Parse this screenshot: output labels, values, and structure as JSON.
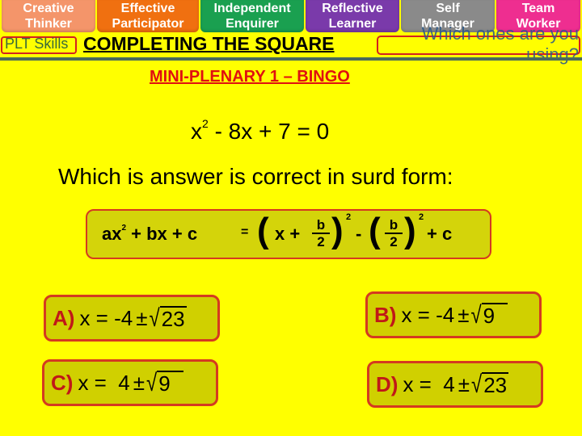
{
  "plt_tabs": [
    {
      "line1": "Creative",
      "line2": "Thinker",
      "color": "#f4956a"
    },
    {
      "line1": "Effective",
      "line2": "Participator",
      "color": "#f07010"
    },
    {
      "line1": "Independent",
      "line2": "Enquirer",
      "color": "#1aa050"
    },
    {
      "line1": "Reflective",
      "line2": "Learner",
      "color": "#7a3aaa"
    },
    {
      "line1": "Self",
      "line2": "Manager",
      "color": "#8a8a8a"
    },
    {
      "line1": "Team",
      "line2": "Worker",
      "color": "#ee2e90"
    }
  ],
  "plt_label": "PLT Skills",
  "title": "COMPLETING THE SQUARE",
  "which_prompt": "Which ones are you using?",
  "subtitle": "MINI-PLENARY 1 – BINGO",
  "equation": {
    "base": "x",
    "exp": "2",
    "rest": " - 8x + 7 = 0"
  },
  "question": "Which is answer is correct in surd form:",
  "formula": {
    "lhs": "ax",
    "lhs_exp": "2",
    "lhs_rest": " + bx + c",
    "eq": "=",
    "open": "(",
    "x_plus": "x +",
    "num": "b",
    "den": "2",
    "close": ")",
    "sq": "2",
    "minus": "-",
    "plus_c": "+ c"
  },
  "answers": [
    {
      "label": "A)",
      "prefix": "x = -4",
      "pm": "±",
      "radicand": "23"
    },
    {
      "label": "B)",
      "prefix": "x = -4",
      "pm": "±",
      "radicand": "9"
    },
    {
      "label": "C)",
      "prefix": "x =  4",
      "pm": "±",
      "radicand": "9"
    },
    {
      "label": "D)",
      "prefix": "x =  4",
      "pm": "±",
      "radicand": "23"
    }
  ]
}
